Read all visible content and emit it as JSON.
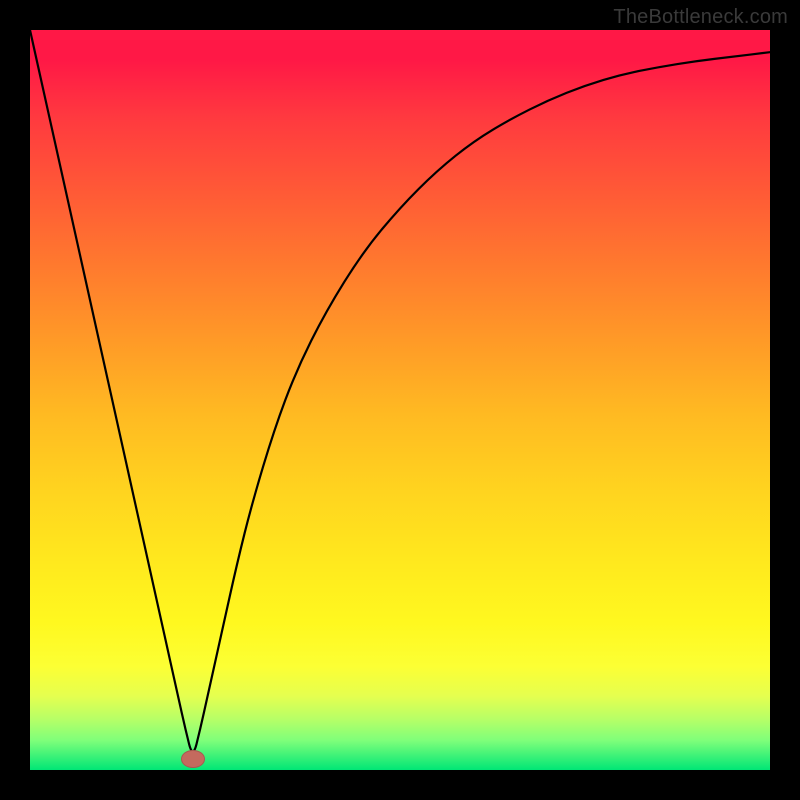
{
  "watermark": "TheBottleneck.com",
  "colors": {
    "frame": "#000000",
    "curve": "#000000",
    "marker": "#c46a5e",
    "gradient_top": "#ff1846",
    "gradient_bottom": "#00e676"
  },
  "chart_data": {
    "type": "line",
    "title": "",
    "xlabel": "",
    "ylabel": "",
    "xlim": [
      0,
      100
    ],
    "ylim": [
      0,
      100
    ],
    "grid": false,
    "legend": false,
    "background": "vertical-gradient (red→orange→yellow→green)",
    "marker": {
      "x": 22,
      "y": 1.5,
      "rx": 1.6,
      "ry": 1.2
    },
    "series": [
      {
        "name": "bottleneck-curve",
        "x": [
          0,
          2,
          4,
          6,
          8,
          10,
          12,
          14,
          16,
          18,
          20,
          21,
          22,
          23,
          24,
          26,
          28,
          30,
          33,
          36,
          40,
          45,
          50,
          55,
          60,
          65,
          70,
          75,
          80,
          85,
          90,
          95,
          100
        ],
        "y": [
          100,
          91,
          82,
          73,
          64,
          55,
          46,
          37,
          28,
          19,
          10,
          5.5,
          1.5,
          5.5,
          10,
          19,
          28,
          36,
          46,
          54,
          62,
          70,
          76,
          81,
          85,
          88,
          90.5,
          92.5,
          94,
          95,
          95.8,
          96.4,
          97
        ]
      }
    ]
  }
}
